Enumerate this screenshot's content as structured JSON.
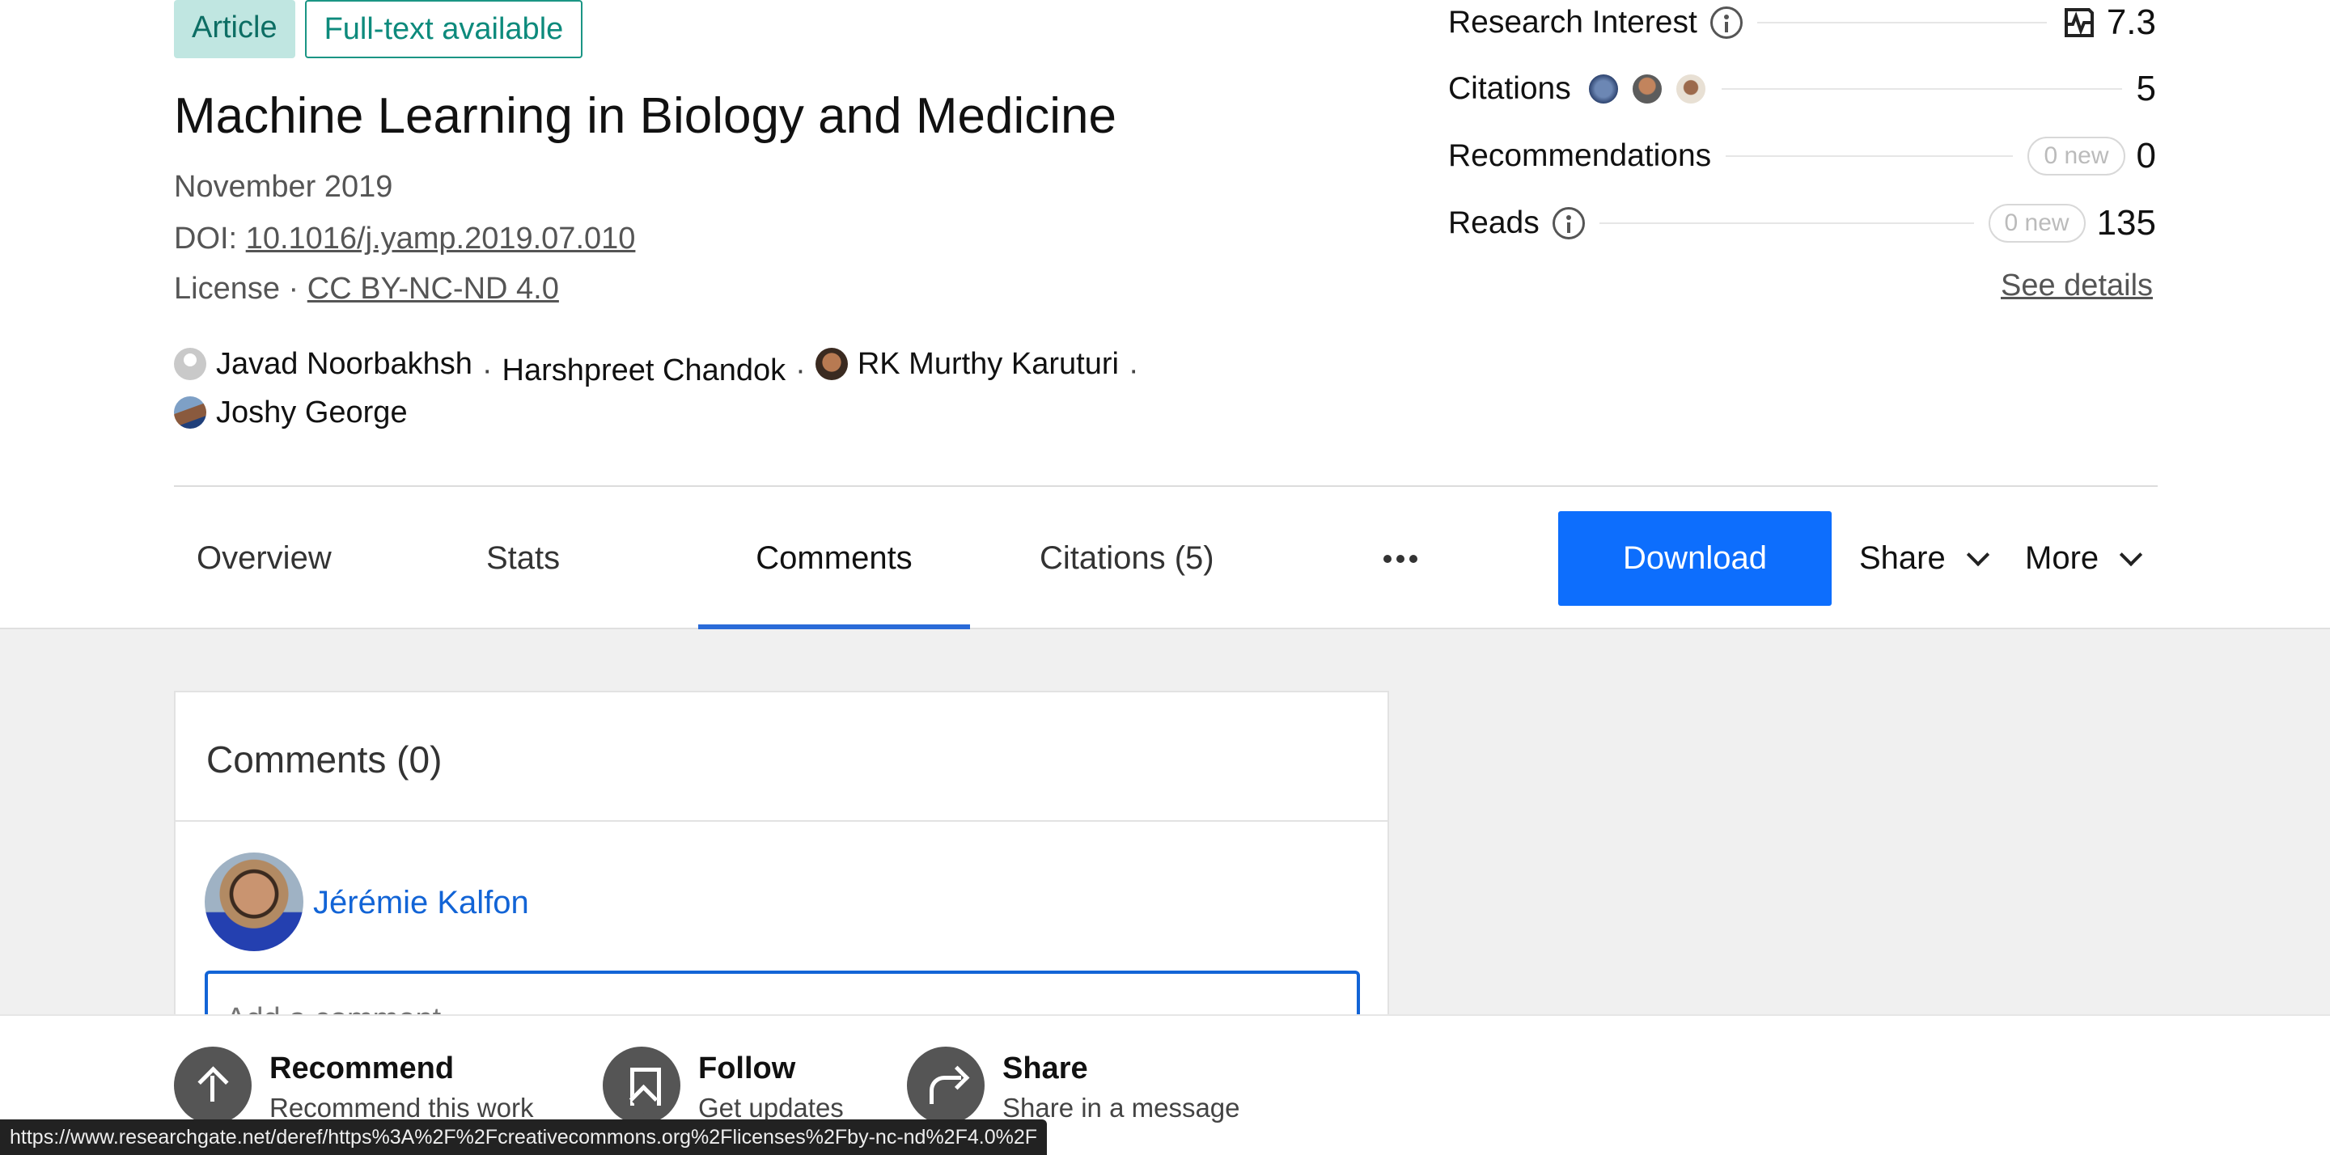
{
  "badges": {
    "article": "Article",
    "fulltext": "Full-text available"
  },
  "title": "Machine Learning in Biology and Medicine",
  "meta": {
    "date": "November 2019",
    "doi_label": "DOI: ",
    "doi_value": "10.1016/j.yamp.2019.07.010",
    "license_label": "License · ",
    "license_value": "CC BY-NC-ND 4.0"
  },
  "authors": [
    {
      "name": "Javad Noorbakhsh"
    },
    {
      "name": "Harshpreet Chandok"
    },
    {
      "name": "RK Murthy Karuturi"
    },
    {
      "name": "Joshy George"
    }
  ],
  "author_separator": "·",
  "stats": {
    "research_interest": {
      "label": "Research Interest",
      "value": "7.3"
    },
    "citations": {
      "label": "Citations",
      "value": "5"
    },
    "recommendations": {
      "label": "Recommendations",
      "new": "0 new",
      "value": "0"
    },
    "reads": {
      "label": "Reads",
      "new": "0 new",
      "value": "135"
    },
    "see_details": "See details"
  },
  "tabs": [
    {
      "label": "Overview"
    },
    {
      "label": "Stats"
    },
    {
      "label": "Comments",
      "active": true
    },
    {
      "label": "Citations (5)"
    }
  ],
  "actions": {
    "download": "Download",
    "share": "Share",
    "more": "More"
  },
  "comments": {
    "title": "Comments (0)",
    "user_name": "Jérémie Kalfon",
    "placeholder": "Add a comment"
  },
  "action_bar": {
    "recommend": {
      "title": "Recommend",
      "sub": "Recommend this work"
    },
    "follow": {
      "title": "Follow",
      "sub": "Get updates"
    },
    "share": {
      "title": "Share",
      "sub": "Share in a message"
    }
  },
  "status_url": "https://www.researchgate.net/deref/https%3A%2F%2Fcreativecommons.org%2Flicenses%2Fby-nc-nd%2F4.0%2F",
  "colors": {
    "primary": "#0d6efd",
    "link": "#1264d6",
    "tab_active": "#2a6bd8",
    "badge_teal": "#c0e6e1"
  }
}
